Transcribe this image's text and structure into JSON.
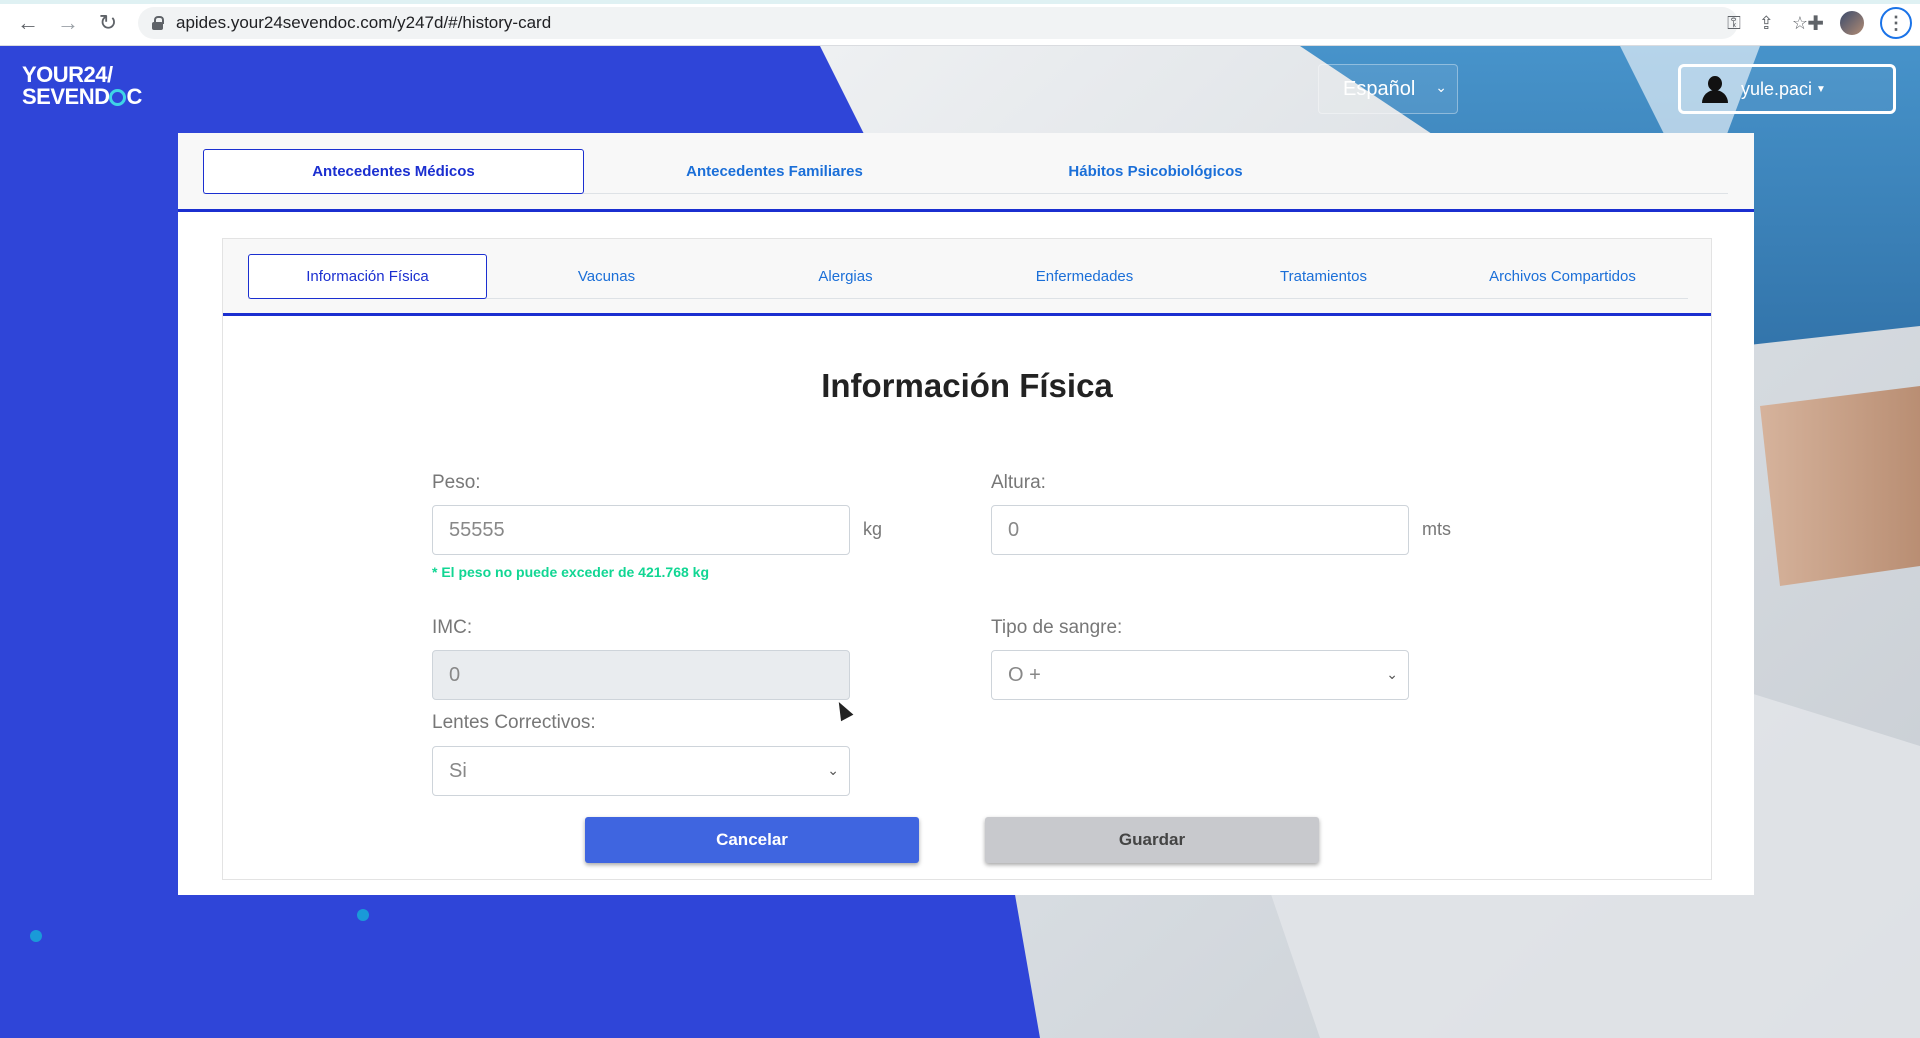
{
  "browser": {
    "url": "apides.your24sevendoc.com/y247d/#/history-card",
    "back_icon": "←",
    "forward_icon": "→",
    "reload_icon": "↻",
    "key_icon": "⚿",
    "share_icon": "⇪",
    "star_icon": "☆",
    "extensions_icon": "✚",
    "menu_icon": "⋮"
  },
  "header": {
    "logo_line1": "YOUR24/",
    "logo_line2_a": "SEVEN",
    "logo_line2_b": "D",
    "logo_line2_c": "C",
    "language": "Español",
    "username": "yule.paci"
  },
  "top_tabs": [
    {
      "label": "Antecedentes Médicos",
      "active": true
    },
    {
      "label": "Antecedentes Familiares",
      "active": false
    },
    {
      "label": "Hábitos Psicobiológicos",
      "active": false
    }
  ],
  "sub_tabs": [
    {
      "label": "Información Física",
      "active": true
    },
    {
      "label": "Vacunas",
      "active": false
    },
    {
      "label": "Alergias",
      "active": false
    },
    {
      "label": "Enfermedades",
      "active": false
    },
    {
      "label": "Tratamientos",
      "active": false
    },
    {
      "label": "Archivos Compartidos",
      "active": false
    }
  ],
  "form": {
    "title": "Información Física",
    "peso_label": "Peso:",
    "peso_value": "55555",
    "peso_unit": "kg",
    "peso_error": "* El peso no puede exceder de 421.768 kg",
    "altura_label": "Altura:",
    "altura_value": "0",
    "altura_unit": "mts",
    "imc_label": "IMC:",
    "imc_value": "0",
    "sangre_label": "Tipo de sangre:",
    "sangre_value": "O +",
    "lentes_label": "Lentes Correctivos:",
    "lentes_value": "Si",
    "cancel_label": "Cancelar",
    "save_label": "Guardar"
  },
  "colors": {
    "brand_blue": "#2f45d8",
    "tab_active_border": "#1b2fd0",
    "tab_text": "#1b6fd8",
    "error_green": "#11d693",
    "cancel_button": "#3f65e0",
    "save_button": "#c8c9cd"
  }
}
